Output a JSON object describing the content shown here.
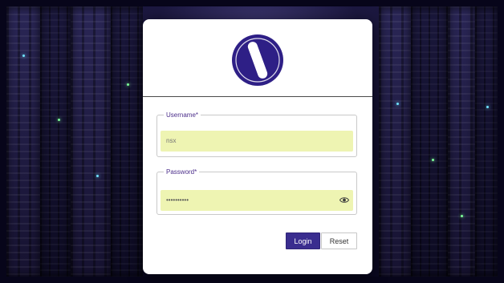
{
  "login": {
    "username_label": "Username*",
    "username_placeholder": "nsx",
    "password_label": "Password*",
    "password_value": "••••••••••",
    "login_button": "Login",
    "reset_button": "Reset"
  },
  "icons": {
    "logo": "brand-logo-icon",
    "reveal_password": "eye-icon"
  },
  "colors": {
    "accent": "#3a2d8f",
    "label": "#4b2d8a",
    "input_fill": "#eef4b2",
    "card": "#ffffff"
  }
}
